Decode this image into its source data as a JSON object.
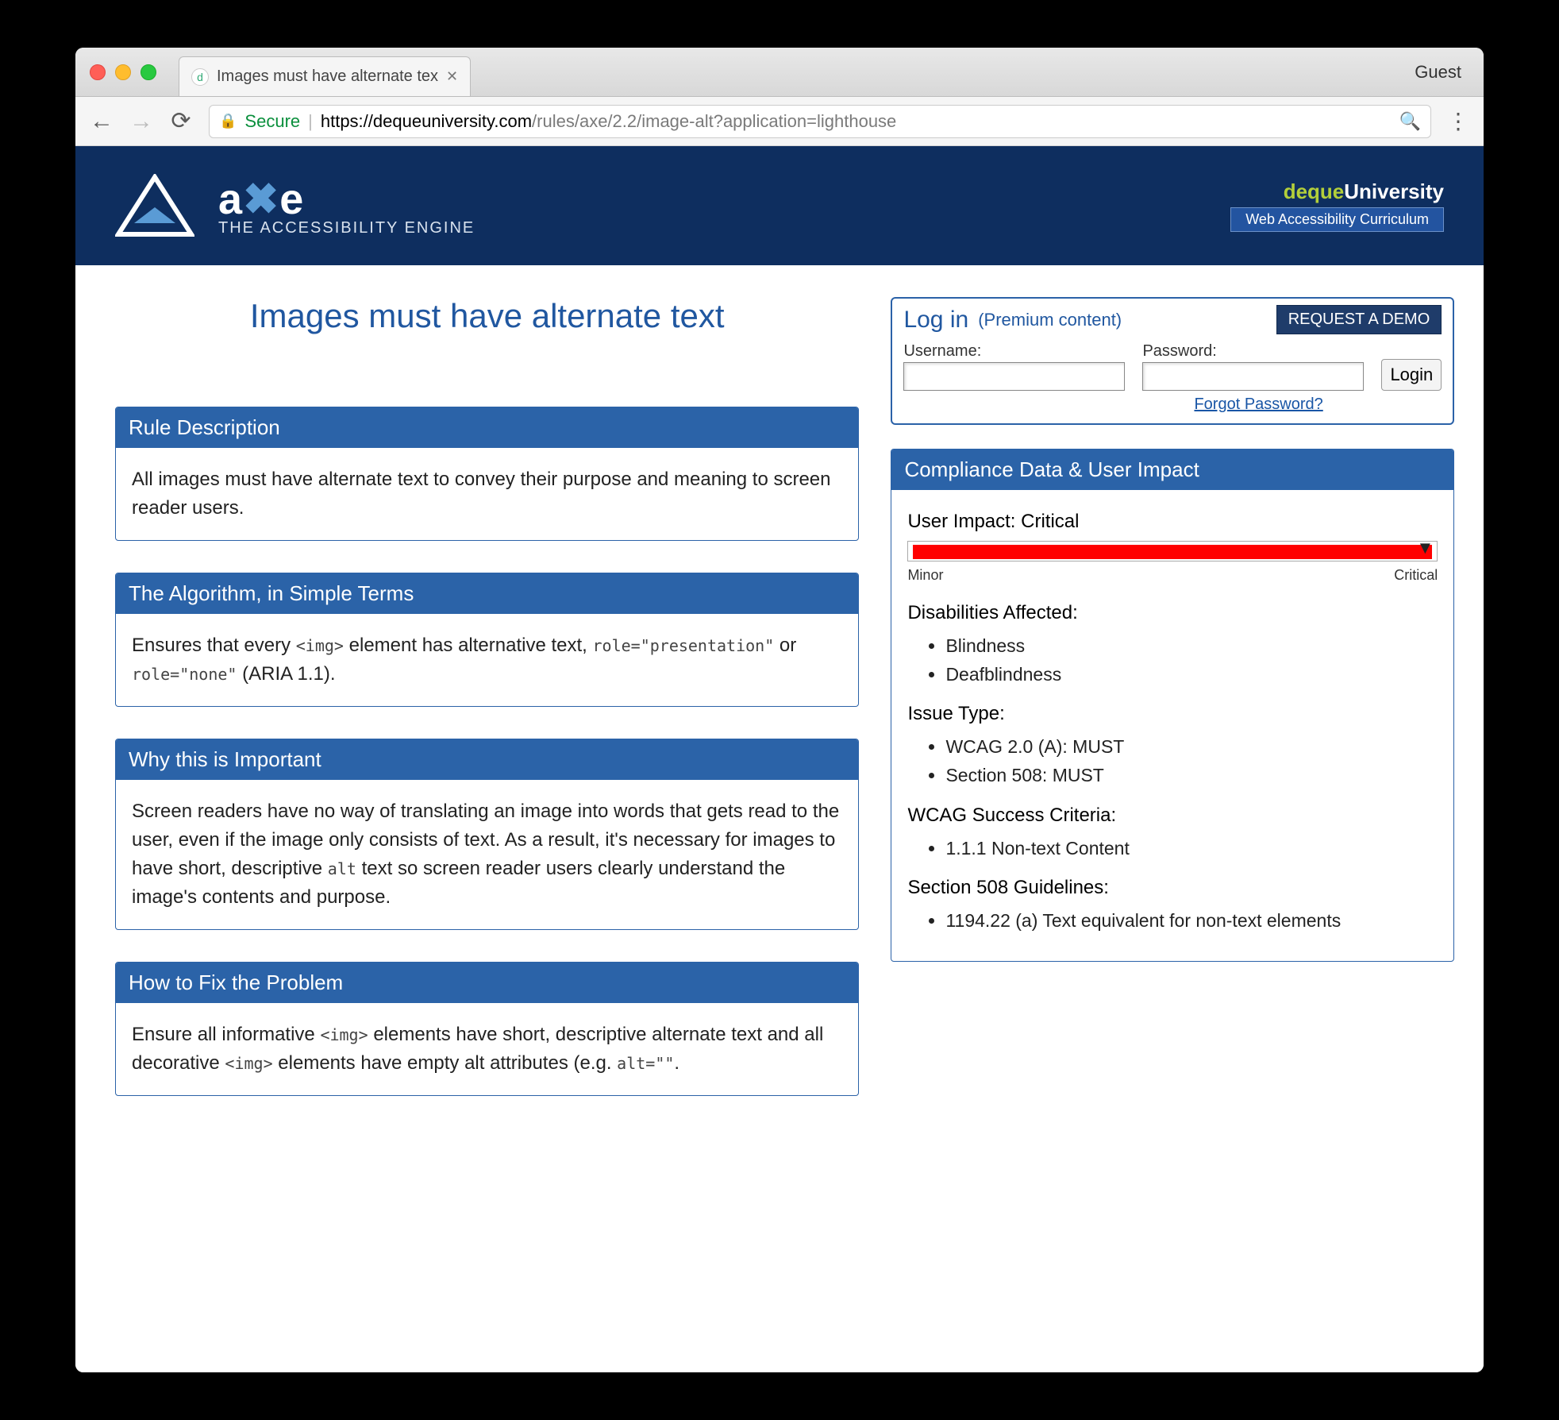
{
  "window": {
    "tab_title": "Images must have alternate tex",
    "guest_label": "Guest"
  },
  "toolbar": {
    "secure_label": "Secure",
    "url_scheme": "https://",
    "url_host": "dequeuniversity.com",
    "url_path": "/rules/axe/2.2/image-alt?application=lighthouse"
  },
  "banner": {
    "brand": "axe",
    "tagline": "THE ACCESSIBILITY ENGINE",
    "deque": "deque",
    "university": "University",
    "curriculum": "Web Accessibility Curriculum"
  },
  "login": {
    "heading": "Log in",
    "premium": "(Premium content)",
    "demo_btn": "REQUEST A DEMO",
    "username_label": "Username:",
    "password_label": "Password:",
    "login_btn": "Login",
    "forgot": "Forgot Password?"
  },
  "page": {
    "title": "Images must have alternate text"
  },
  "panels": {
    "rule": {
      "title": "Rule Description",
      "body": "All images must have alternate text to convey their purpose and meaning to screen reader users."
    },
    "algo": {
      "title": "The Algorithm, in Simple Terms",
      "body_pre": "Ensures that every ",
      "code1": "<img>",
      "body_mid": " element has alternative text, ",
      "code2": "role=\"presentation\"",
      "body_mid2": " or ",
      "code3": "role=\"none\"",
      "body_post": " (ARIA 1.1)."
    },
    "why": {
      "title": "Why this is Important",
      "body_pre": "Screen readers have no way of translating an image into words that gets read to the user, even if the image only consists of text. As a result, it's necessary for images to have short, descriptive ",
      "code1": "alt",
      "body_post": " text so screen reader users clearly understand the image's contents and purpose."
    },
    "fix": {
      "title": "How to Fix the Problem",
      "body_pre": "Ensure all informative ",
      "code1": "<img>",
      "body_mid": " elements have short, descriptive alternate text and all decorative ",
      "code2": "<img>",
      "body_mid2": " elements have empty alt attributes (e.g. ",
      "code3": "alt=\"\"",
      "body_post": "."
    }
  },
  "compliance": {
    "title": "Compliance Data & User Impact",
    "impact_label": "User Impact: ",
    "impact_value": "Critical",
    "scale_min": "Minor",
    "scale_max": "Critical",
    "disabilities_h": "Disabilities Affected:",
    "disabilities": [
      "Blindness",
      "Deafblindness"
    ],
    "issuetype_h": "Issue Type:",
    "issuetypes": [
      "WCAG 2.0 (A): MUST",
      "Section 508: MUST"
    ],
    "wcag_h": "WCAG Success Criteria:",
    "wcag": [
      "1.1.1 Non-text Content"
    ],
    "s508_h": "Section 508 Guidelines:",
    "s508": [
      "1194.22 (a) Text equivalent for non-text elements"
    ]
  }
}
